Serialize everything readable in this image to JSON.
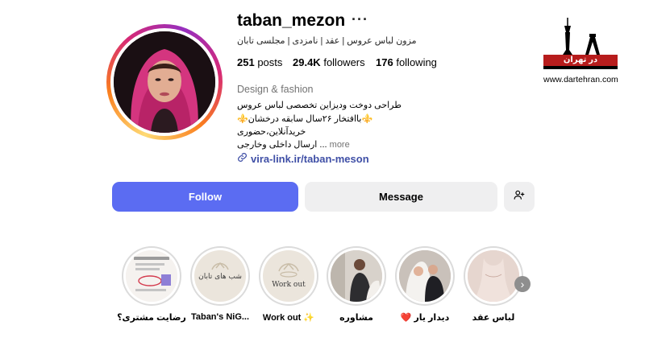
{
  "profile": {
    "username": "taban_mezon",
    "options_icon": "more-horizontal-icon",
    "full_name": "مزون لباس عروس | عقد | نامزدی | مجلسی تابان",
    "stats": {
      "posts_value": "251",
      "posts_label": "posts",
      "followers_value": "29.4K",
      "followers_label": "followers",
      "following_value": "176",
      "following_label": "following"
    },
    "category": "Design & fashion",
    "bio": [
      "طراحی دوخت ودیزاین تخصصی لباس عروس",
      "⚜️باافتخار ۲۶سال سابقه درخشان⚜️",
      "خریدآنلاین،حضوری",
      "ارسال داخلی وخارجی ..."
    ],
    "more": "more",
    "link": "vira-link.ir/taban-meson",
    "link_icon": "link-icon"
  },
  "actions": {
    "follow": "Follow",
    "message": "Message",
    "suggest_icon": "add-person-icon"
  },
  "highlights": [
    {
      "label": "رضایت مشتری؟",
      "inner_text": ""
    },
    {
      "label": "Taban's NiG...",
      "inner_text": "شب های تابان"
    },
    {
      "label": "Work out ✨",
      "inner_text": "Work out"
    },
    {
      "label": "مشاوره",
      "inner_text": ""
    },
    {
      "label": "❤️ دیدار یار",
      "inner_text": ""
    },
    {
      "label": "لباس عقد",
      "inner_text": ""
    }
  ],
  "next_icon": "chevron-right-icon",
  "watermark": {
    "text": "در تهران",
    "url": "www.dartehran.com"
  },
  "colors": {
    "follow_blue": "#5b6cf2",
    "link_blue": "#3f4fa6",
    "secondary_gray": "#efeff0",
    "muted_text": "#737373"
  }
}
